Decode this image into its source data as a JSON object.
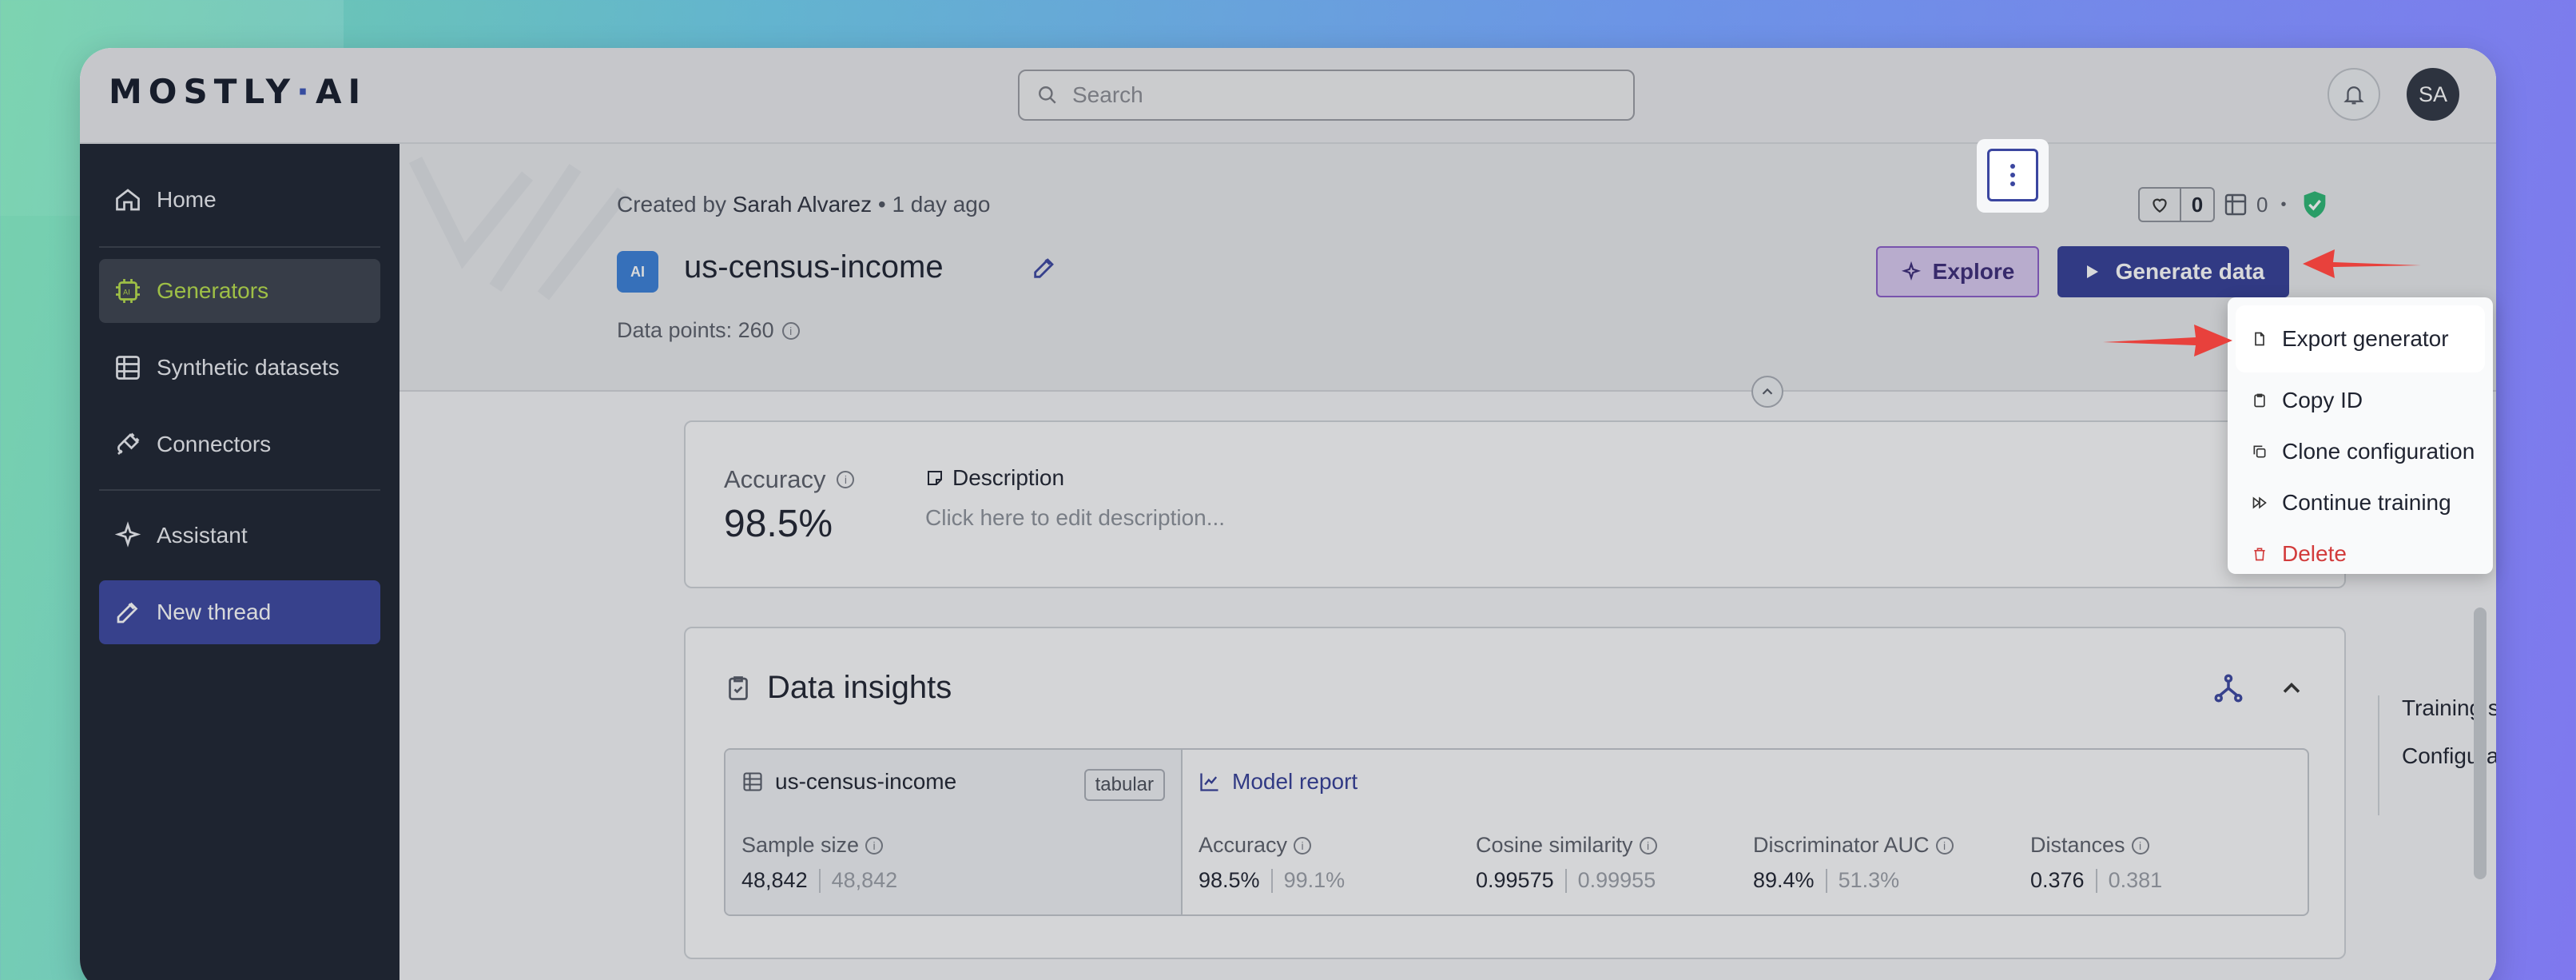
{
  "header": {
    "logo_left": "MOSTLY",
    "logo_dot": "·",
    "logo_right": "AI",
    "search_placeholder": "Search",
    "avatar_initials": "SA"
  },
  "sidebar": {
    "items": [
      {
        "label": "Home",
        "icon": "home-icon"
      },
      {
        "label": "Generators",
        "icon": "ai-chip-icon",
        "active": true
      },
      {
        "label": "Synthetic datasets",
        "icon": "table-icon"
      },
      {
        "label": "Connectors",
        "icon": "plug-icon"
      },
      {
        "label": "Assistant",
        "icon": "sparkle-icon"
      },
      {
        "label": "New thread",
        "icon": "edit-icon"
      }
    ]
  },
  "generator": {
    "created_prefix": "Created by",
    "created_by": "Sarah Alvarez",
    "created_sep": "•",
    "created_when": "1 day ago",
    "icon_text": "AI",
    "name": "us-census-income",
    "data_points_label": "Data points: 260",
    "likes": "0",
    "datasets_count": "0",
    "stats_sep": "•"
  },
  "actions": {
    "explore": "Explore",
    "generate": "Generate data"
  },
  "summary": {
    "accuracy_label": "Accuracy",
    "accuracy_value": "98.5%",
    "description_label": "Description",
    "description_placeholder": "Click here to edit description..."
  },
  "insights": {
    "title": "Data insights",
    "dataset_name": "us-census-income",
    "dataset_type": "tabular",
    "sample_size_label": "Sample size",
    "sample_size_a": "48,842",
    "sample_size_b": "48,842",
    "model_report": "Model report",
    "metrics": [
      {
        "label": "Accuracy",
        "a": "98.5%",
        "b": "99.1%"
      },
      {
        "label": "Cosine similarity",
        "a": "0.99575",
        "b": "0.99955"
      },
      {
        "label": "Discriminator AUC",
        "a": "89.4%",
        "b": "51.3%"
      },
      {
        "label": "Distances",
        "a": "0.376",
        "b": "0.381"
      }
    ]
  },
  "right_nav": {
    "items": [
      "Training status",
      "Configuration"
    ]
  },
  "menu": {
    "items": [
      {
        "label": "Export generator",
        "icon": "file-icon"
      },
      {
        "label": "Copy ID",
        "icon": "clipboard-icon"
      },
      {
        "label": "Clone configuration",
        "icon": "copy-icon"
      },
      {
        "label": "Continue training",
        "icon": "fast-forward-icon"
      },
      {
        "label": "Delete",
        "icon": "trash-icon",
        "color": "#d23b3b"
      }
    ]
  },
  "colors": {
    "accent": "#343e96",
    "sidebar_bg": "#1d2330",
    "active_text": "#b9e04b",
    "success": "#2bb673",
    "danger": "#d23b3b",
    "annotation_arrow": "#e8413c"
  }
}
